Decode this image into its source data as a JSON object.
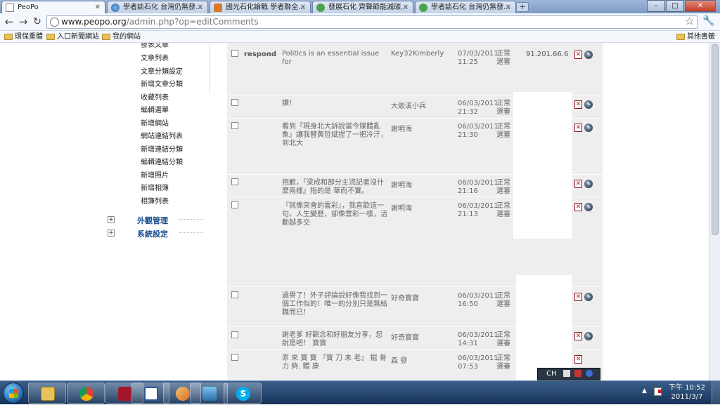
{
  "browser": {
    "tabs": [
      {
        "label": "PeoPo"
      },
      {
        "label": "學者談石化 台灣仍無發..."
      },
      {
        "label": "國光石化論戰 學者聯全..."
      },
      {
        "label": "發展石化 齊聲節能減碳..."
      },
      {
        "label": "學者談石化 台灣仍無發..."
      }
    ],
    "new_tab": "+",
    "window_controls": {
      "minimize": "–",
      "maximize": "□",
      "close": "✕"
    },
    "url_host": "www.peopo.org",
    "url_path": "/admin.php?op=editComments",
    "bookmarks": [
      {
        "label": "環保重體"
      },
      {
        "label": "入口新聞網站"
      },
      {
        "label": "我的網站"
      }
    ],
    "other_bookmarks": "其他書籤"
  },
  "sidebar": {
    "menu": [
      "發表文章",
      "文章列表",
      "文章分類設定",
      "新增文章分類",
      "收藏列表",
      "編輯選單",
      "新增網站",
      "網站連結列表",
      "新增連結分類",
      "編輯連結分類",
      "新增照片",
      "新增相簿",
      "相簿列表"
    ],
    "sections": [
      {
        "label": "外觀管理",
        "toggle": "+"
      },
      {
        "label": "系統設定",
        "toggle": "+"
      }
    ]
  },
  "comments": [
    {
      "title": "respond",
      "content": "Politics is an essential issue for",
      "author": "Key32Kimberly",
      "date": "07/03/2011",
      "time": "11:25",
      "status": "正常選審",
      "ip": "91.201.66.6"
    },
    {
      "title": "",
      "content": "讚！",
      "author": "大嵌溪小兵",
      "date": "06/03/2011",
      "time": "21:32",
      "status": "正常選審",
      "ip": ""
    },
    {
      "title": "",
      "content": "看到『現身北大訴說當今媒體亂象』讓我替黃哲斌捏了一把冷汗，到北大",
      "author": "謝明海",
      "date": "06/03/2011",
      "time": "21:30",
      "status": "正常選審",
      "ip": ""
    },
    {
      "title": "",
      "content": "抱歉，『梁成和部分主流記者沒什麼兩樣』指的是 華而不實。",
      "author": "謝明海",
      "date": "06/03/2011",
      "time": "21:16",
      "status": "正常選審",
      "ip": ""
    },
    {
      "title": "",
      "content": "『就像突會的雲彩』，我喜歡這一句。人生變歷，卻像雲彩一樣，活動越多交",
      "author": "謝明海",
      "date": "06/03/2011",
      "time": "21:13",
      "status": "正常選審",
      "ip": ""
    },
    {
      "title": "",
      "content": "過譽了！外子評論說好像我找到一個工作似的！唯一的分別只是無給職而已！",
      "author": "好奇寶寶",
      "date": "06/03/2011",
      "time": "16:50",
      "status": "正常選審",
      "ip": ""
    },
    {
      "title": "",
      "content": "謝老爹 好觀念和好朋友分享，您說是吧！ 寶寶",
      "author": "好奇寶寶",
      "date": "06/03/2011",
      "time": "14:31",
      "status": "正常選審",
      "ip": ""
    },
    {
      "title": "",
      "content": "原 來 寶 寶 『寶 刀 未 老』 掘 骨 力 夠. 體 康",
      "author": "森 發",
      "date": "06/03/2011",
      "time": "07:53",
      "status": "正常選審",
      "ip": ""
    }
  ],
  "row_actions": {
    "delete": "✕",
    "edit": "✎"
  },
  "language_bar": "CH",
  "taskbar": {
    "apps": [
      "file-explorer",
      "chrome",
      "app-red",
      "word",
      "paint",
      "photo-viewer",
      "skype"
    ],
    "skype_glyph": "S",
    "clock_time": "下午 10:52",
    "clock_date": "2011/3/7"
  },
  "colors": {
    "section_label": "#1c4f8c",
    "comment_bg": "#eeeeee",
    "taskbar": "#163358"
  }
}
